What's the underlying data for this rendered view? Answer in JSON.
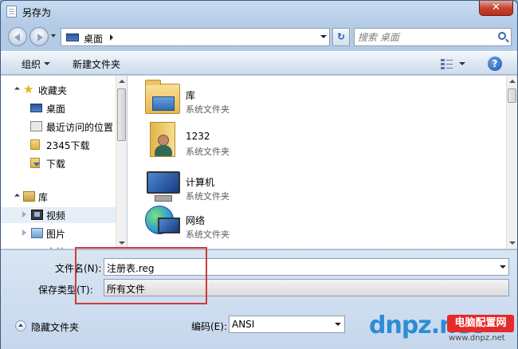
{
  "window": {
    "title": "另存为",
    "close_label": "✕"
  },
  "address": {
    "location": "桌面",
    "search_placeholder": "搜索 桌面",
    "refresh_label": "↻"
  },
  "toolbar": {
    "organize": "组织",
    "new_folder": "新建文件夹",
    "help": "?"
  },
  "nav": {
    "items": [
      {
        "label": "收藏夹",
        "icon": "star-icon"
      },
      {
        "label": "桌面",
        "icon": "desktop-icon"
      },
      {
        "label": "最近访问的位置",
        "icon": "recent-places-icon"
      },
      {
        "label": "2345下载",
        "icon": "folder-icon"
      },
      {
        "label": "下载",
        "icon": "download-folder-icon"
      },
      {
        "label": "库",
        "icon": "library-icon"
      },
      {
        "label": "视频",
        "icon": "video-icon"
      },
      {
        "label": "图片",
        "icon": "picture-icon"
      },
      {
        "label": "文档",
        "icon": "document-icon"
      }
    ]
  },
  "files": [
    {
      "name": "库",
      "type": "系统文件夹",
      "icon": "library-folder-icon"
    },
    {
      "name": "1232",
      "type": "系统文件夹",
      "icon": "user-folder-icon"
    },
    {
      "name": "计算机",
      "type": "系统文件夹",
      "icon": "computer-icon"
    },
    {
      "name": "网络",
      "type": "系统文件夹",
      "icon": "network-icon"
    }
  ],
  "form": {
    "filename_label": "文件名(N):",
    "filename_value": "注册表.reg",
    "filetype_label": "保存类型(T):",
    "filetype_value": "所有文件",
    "hide_folders": "隐藏文件夹",
    "encoding_label": "编码(E):",
    "encoding_value": "ANSI"
  },
  "watermark": {
    "logo": "dnpz.net",
    "tag": "电脑配置网",
    "url": "www.dnpz.net"
  },
  "colors": {
    "accent": "#2a58a8",
    "highlight_box": "#d13a3a"
  }
}
